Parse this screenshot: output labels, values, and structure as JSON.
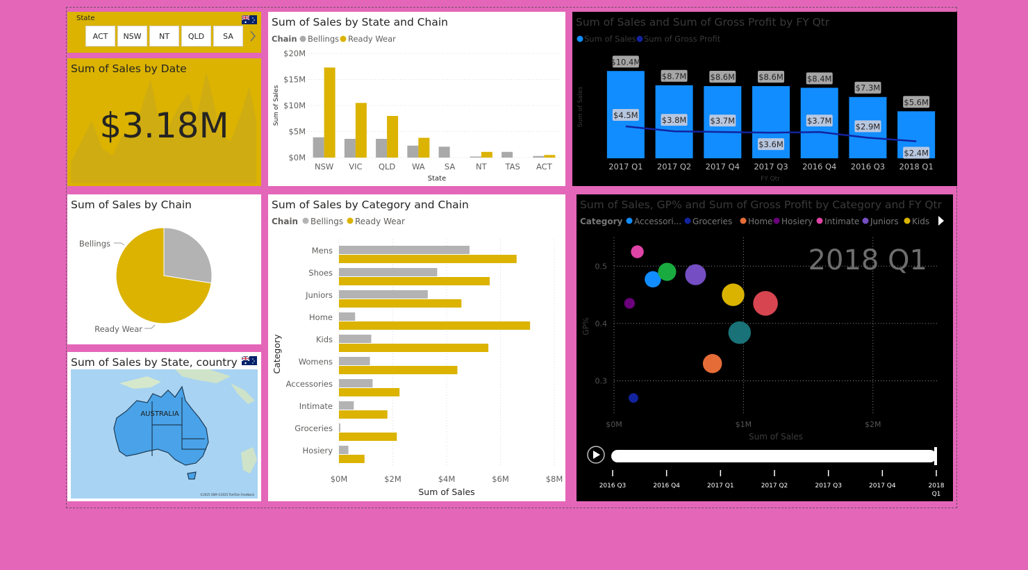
{
  "slicer": {
    "title": "State",
    "items": [
      "ACT",
      "NSW",
      "NT",
      "QLD",
      "SA"
    ]
  },
  "card": {
    "title": "Sum of Sales by Date",
    "value": "$3.18M"
  },
  "map": {
    "title": "Sum of Sales by State, country",
    "label": "AUSTRALIA",
    "attribution": "©2025 OSM ©2025 TomTom Feedback"
  },
  "pie": {
    "title": "Sum of Sales by Chain",
    "labels": [
      "Bellings",
      "Ready Wear"
    ]
  },
  "colors": {
    "gold": "#dbb300",
    "grey": "#a9a9a9",
    "pink": "#e466b9",
    "blue": "#118dff",
    "navy": "#12239e"
  },
  "chart_data": [
    {
      "id": "state_chain",
      "type": "bar",
      "title": "Sum of Sales by State and Chain",
      "legend_title": "Chain",
      "xlabel": "State",
      "ylabel": "Sum of Sales",
      "categories": [
        "NSW",
        "VIC",
        "QLD",
        "WA",
        "SA",
        "NT",
        "TAS",
        "ACT"
      ],
      "series": [
        {
          "name": "Bellings",
          "values": [
            3.9,
            3.6,
            3.6,
            2.3,
            2.1,
            0.2,
            1.1,
            0.3
          ]
        },
        {
          "name": "Ready Wear",
          "values": [
            17.3,
            10.5,
            8.0,
            3.8,
            0,
            1.1,
            0,
            0.5
          ]
        }
      ],
      "yticks": [
        "$0M",
        "$5M",
        "$10M",
        "$15M",
        "$20M"
      ],
      "ylim": [
        0,
        20
      ]
    },
    {
      "id": "qtr_combo",
      "type": "bar",
      "title": "Sum of Sales and Sum of Gross Profit by FY Qtr",
      "xlabel": "FY Qtr",
      "ylabel": "Sum of Sales",
      "categories": [
        "2017 Q1",
        "2017 Q2",
        "2017 Q4",
        "2017 Q3",
        "2016 Q4",
        "2016 Q3",
        "2018 Q1"
      ],
      "series": [
        {
          "name": "Sum of Sales",
          "values": [
            10.4,
            8.7,
            8.6,
            8.6,
            8.4,
            7.3,
            5.6
          ],
          "labels": [
            "$10.4M",
            "$8.7M",
            "$8.6M",
            "$8.6M",
            "$8.4M",
            "$7.3M",
            "$5.6M"
          ]
        },
        {
          "name": "Sum of Gross Profit",
          "values": [
            4.5,
            3.8,
            3.7,
            3.6,
            3.7,
            2.9,
            2.4
          ],
          "labels": [
            "$4.5M",
            "$3.8M",
            "$3.7M",
            "$3.6M",
            "$3.7M",
            "$2.9M",
            "$2.4M"
          ]
        }
      ]
    },
    {
      "id": "category_chain",
      "type": "bar",
      "orientation": "horizontal",
      "title": "Sum of Sales by Category and Chain",
      "legend_title": "Chain",
      "xlabel": "Sum of Sales",
      "ylabel": "Category",
      "categories": [
        "Mens",
        "Shoes",
        "Juniors",
        "Home",
        "Kids",
        "Womens",
        "Accessories",
        "Intimate",
        "Groceries",
        "Hosiery"
      ],
      "series": [
        {
          "name": "Bellings",
          "values": [
            4.85,
            3.65,
            3.3,
            0.6,
            1.2,
            1.15,
            1.25,
            0.55,
            0.05,
            0.35
          ]
        },
        {
          "name": "Ready Wear",
          "values": [
            6.6,
            5.6,
            4.55,
            7.1,
            5.55,
            4.4,
            2.25,
            1.8,
            2.15,
            0.95
          ]
        }
      ],
      "xticks": [
        "$0M",
        "$2M",
        "$4M",
        "$6M",
        "$8M"
      ],
      "xlim": [
        0,
        8
      ]
    },
    {
      "id": "scatter_gp",
      "type": "scatter",
      "title": "Sum of Sales, GP% and Sum of Gross Profit by Category and FY Qtr",
      "legend_title": "Category",
      "legend": [
        "Accessori...",
        "Groceries",
        "Home",
        "Hosiery",
        "Intimate",
        "Juniors",
        "Kids"
      ],
      "xlabel": "Sum of Sales",
      "ylabel": "GP%",
      "xticks": [
        "$0M",
        "$1M",
        "$2M"
      ],
      "yticks": [
        "0.3",
        "0.4",
        "0.5"
      ],
      "xlim": [
        0,
        2.5
      ],
      "ylim": [
        0.24,
        0.55
      ],
      "play_label": "2018 Q1",
      "timeline": [
        "2016 Q3",
        "2016 Q4",
        "2017 Q1",
        "2017 Q2",
        "2017 Q3",
        "2017 Q4",
        "2018 Q1"
      ],
      "points": [
        {
          "category": "Intimate",
          "x": 0.18,
          "y": 0.525,
          "size": 0.1,
          "color": "#e044a7"
        },
        {
          "category": "Accessories",
          "x": 0.3,
          "y": 0.477,
          "size": 0.22,
          "color": "#118dff"
        },
        {
          "category": "Groceries2",
          "x": 0.41,
          "y": 0.49,
          "size": 0.3,
          "color": "#1aab40"
        },
        {
          "category": "Juniors",
          "x": 0.63,
          "y": 0.485,
          "size": 0.45,
          "color": "#744ec2"
        },
        {
          "category": "Kids",
          "x": 0.92,
          "y": 0.45,
          "size": 0.55,
          "color": "#d9b300"
        },
        {
          "category": "Home",
          "x": 1.17,
          "y": 0.435,
          "size": 0.7,
          "color": "#d64550"
        },
        {
          "category": "Hosiery",
          "x": 0.12,
          "y": 0.435,
          "size": 0.05,
          "color": "#6b007b"
        },
        {
          "category": "Womens",
          "x": 0.97,
          "y": 0.384,
          "size": 0.55,
          "color": "#197278"
        },
        {
          "category": "Home2",
          "x": 0.76,
          "y": 0.33,
          "size": 0.35,
          "color": "#e66c37"
        },
        {
          "category": "Groceries",
          "x": 0.15,
          "y": 0.27,
          "size": 0.03,
          "color": "#12239e"
        }
      ]
    },
    {
      "id": "chain_pie",
      "type": "pie",
      "title": "Sum of Sales by Chain",
      "categories": [
        "Bellings",
        "Ready Wear"
      ],
      "values": [
        27.5,
        72.5
      ]
    }
  ]
}
